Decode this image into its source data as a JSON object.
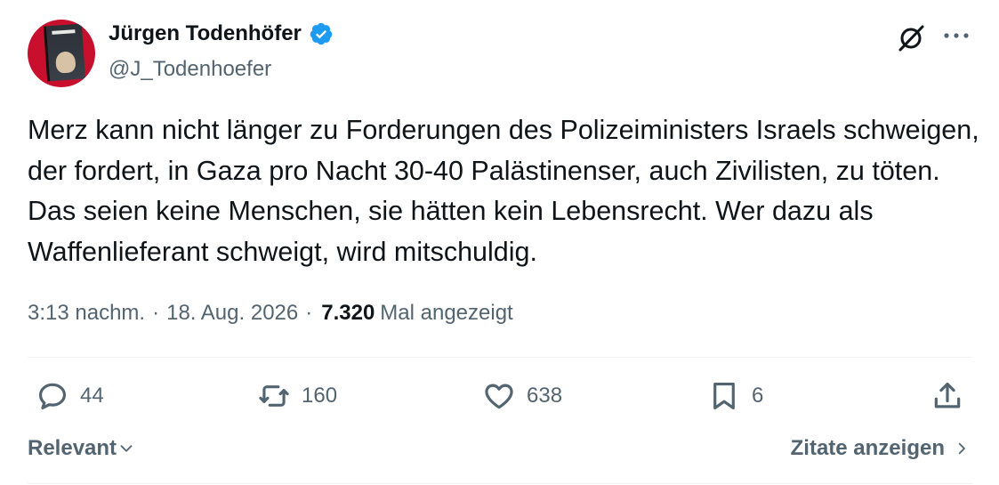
{
  "author": {
    "display_name": "Jürgen Todenhöfer",
    "handle": "@J_Todenhoefer",
    "verified": true
  },
  "tweet": {
    "text": "Merz kann nicht länger zu Forderungen des Polizeiministers Israels schweigen, der fordert, in Gaza pro Nacht 30-40 Palästinenser, auch Zivilisten, zu töten. Das seien keine Menschen, sie hätten kein Lebensrecht. Wer dazu als Waffenlieferant schweigt, wird mitschuldig.",
    "time": "3:13 nachm.",
    "separator": "·",
    "date": "18. Aug. 2026",
    "views_count": "7.320",
    "views_label": "Mal angezeigt"
  },
  "actions": {
    "replies": "44",
    "reposts": "160",
    "likes": "638",
    "bookmarks": "6"
  },
  "footer": {
    "sort_label": "Relevant",
    "quotes_label": "Zitate anzeigen"
  },
  "icons": {
    "verified": "verified-badge-icon",
    "grok": "grok-icon",
    "more": "more-icon",
    "reply": "reply-icon",
    "repost": "repost-icon",
    "like": "heart-icon",
    "bookmark": "bookmark-icon",
    "share": "share-icon",
    "chevron_down": "chevron-down-icon",
    "chevron_right": "chevron-right-icon"
  },
  "colors": {
    "text": "#0f1419",
    "secondary": "#536471",
    "verified": "#1d9bf0",
    "divider": "#eff3f4",
    "avatar_bg": "#c8102e"
  }
}
